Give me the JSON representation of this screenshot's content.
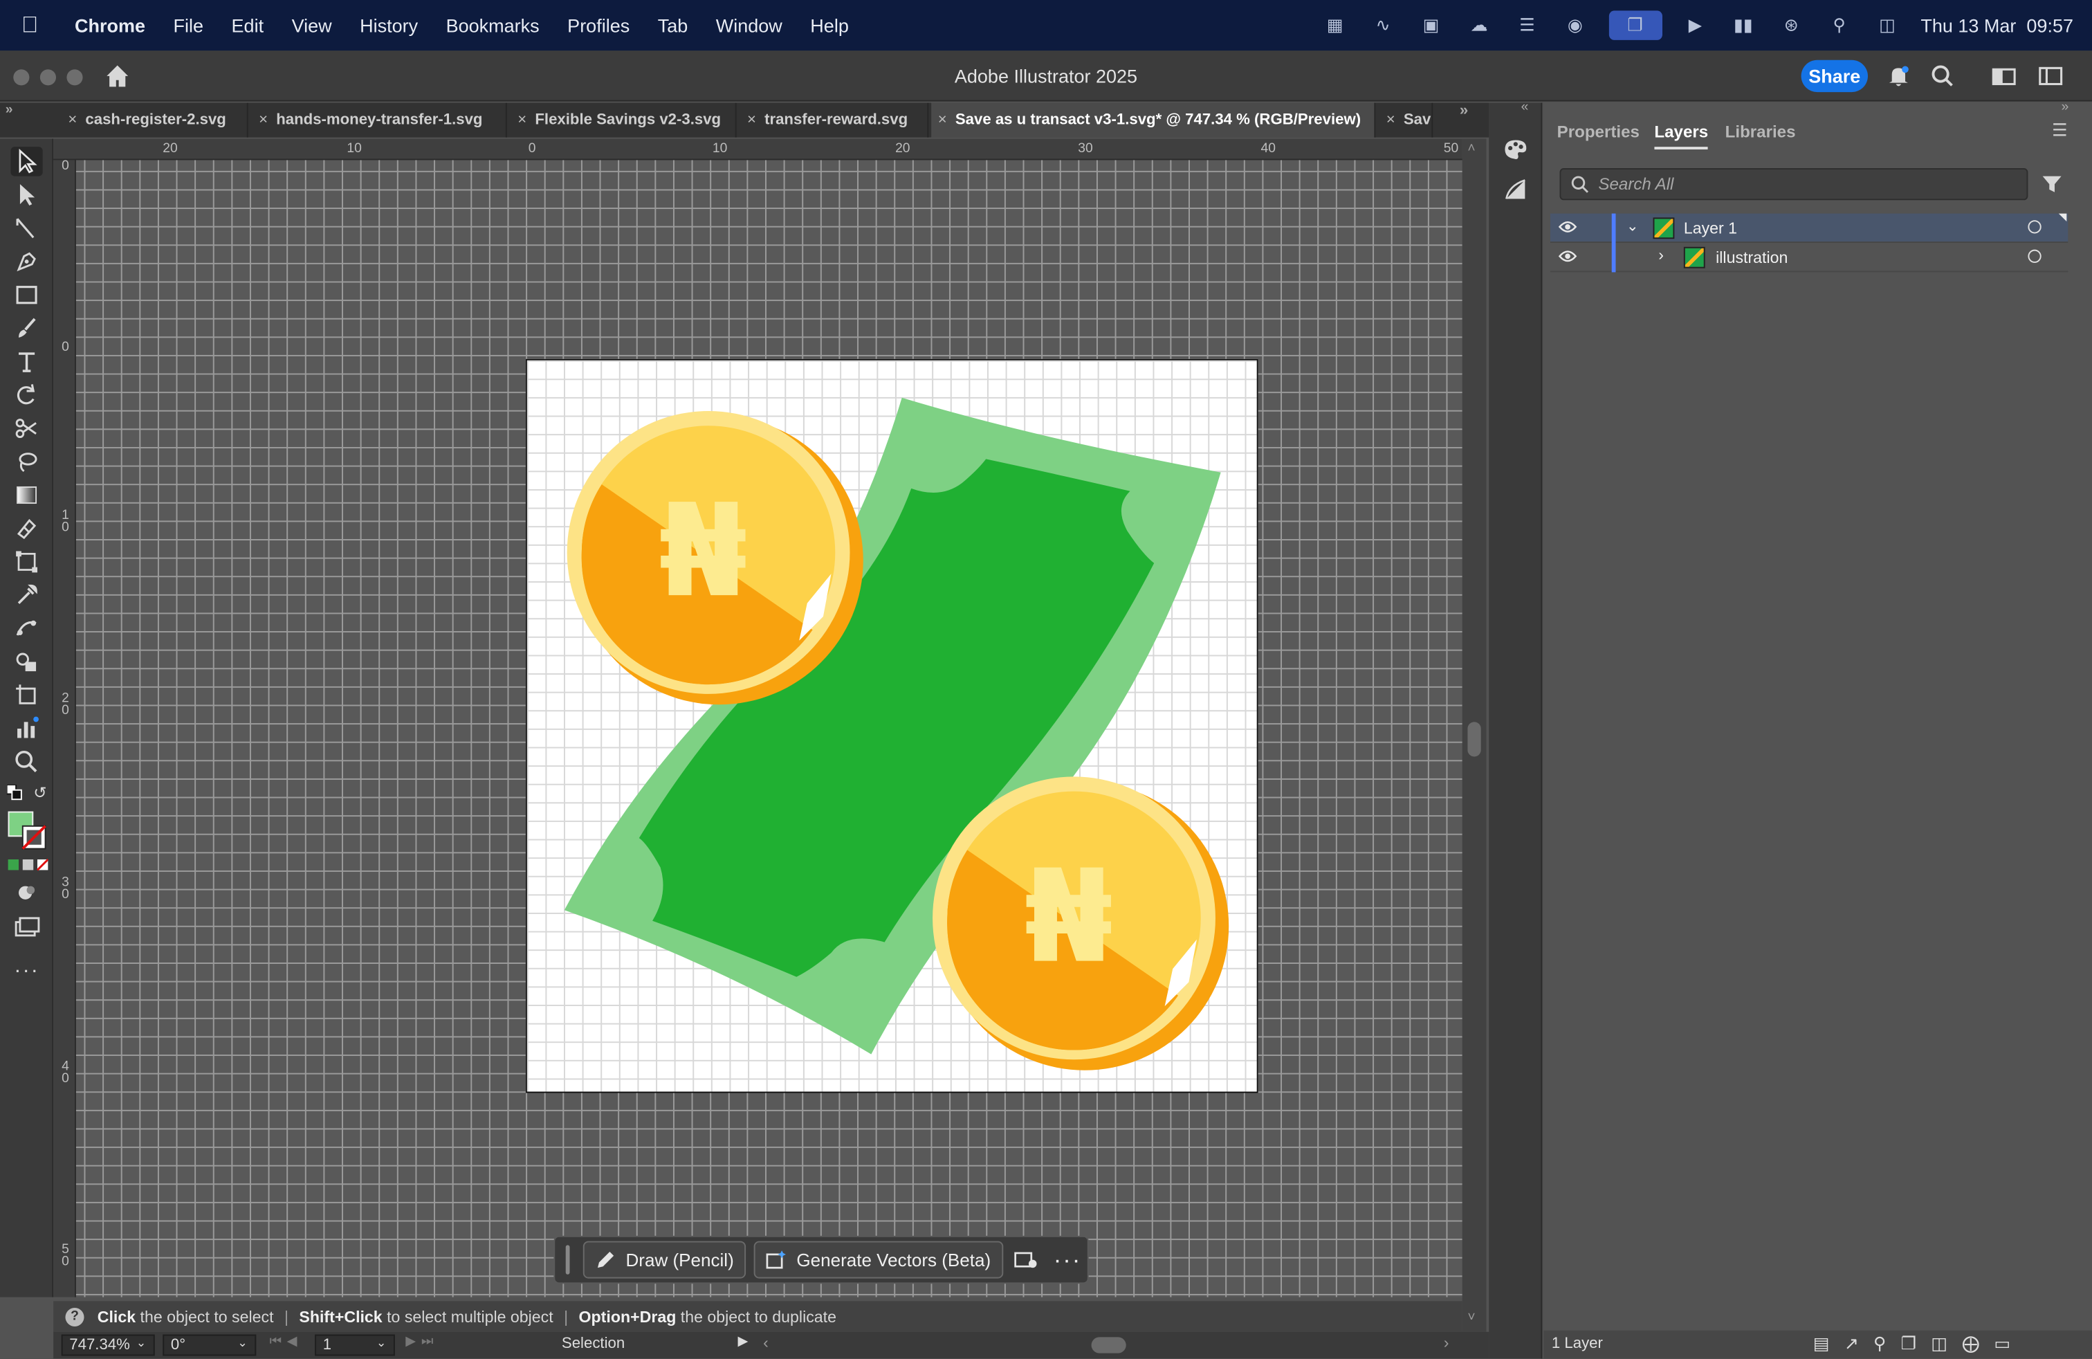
{
  "menubar": {
    "app": "Chrome",
    "items": [
      "File",
      "Edit",
      "View",
      "History",
      "Bookmarks",
      "Profiles",
      "Tab",
      "Window",
      "Help"
    ],
    "clock": "Thu 13 Mar  09:57",
    "icons": [
      "figma-icon",
      "activity-icon",
      "app-icon",
      "creative-cloud-icon",
      "layers-app-icon",
      "cc-sync-icon",
      "screen-mirror-icon",
      "play-icon",
      "battery-icon",
      "wifi-icon",
      "spotlight-icon",
      "control-center-icon"
    ]
  },
  "window": {
    "title": "Adobe Illustrator 2025",
    "share_label": "Share"
  },
  "tabs": [
    {
      "label": "cash-register-2.svg"
    },
    {
      "label": "hands-money-transfer-1.svg"
    },
    {
      "label": "Flexible Savings v2-3.svg"
    },
    {
      "label": "transfer-reward.svg"
    },
    {
      "label": "Save as u transact v3-1.svg* @ 747.34 % (RGB/Preview)",
      "active": true
    },
    {
      "label": "Sav"
    }
  ],
  "ruler": {
    "top_ticks": [
      "20",
      "10",
      "0",
      "10",
      "20",
      "30",
      "40",
      "50"
    ],
    "left_ticks": [
      "0",
      "0",
      "1\n0",
      "2\n0",
      "3\n0",
      "4\n0",
      "5\n0"
    ]
  },
  "taskbar": {
    "draw_label": "Draw (Pencil)",
    "generate_label": "Generate Vectors (Beta)"
  },
  "hint": {
    "k1": "Click",
    "t1": " the object to select",
    "k2": "Shift+Click",
    "t2": " to select multiple object",
    "k3": "Option+Drag",
    "t3": " the object to duplicate"
  },
  "bottom": {
    "zoom": "747.34%",
    "rotation": "0°",
    "artboard": "1",
    "tool": "Selection"
  },
  "panel": {
    "tabs": [
      "Properties",
      "Layers",
      "Libraries"
    ],
    "active_tab": "Layers",
    "search_placeholder": "Search All",
    "layers": [
      {
        "name": "Layer 1",
        "expanded": true,
        "selected": true
      },
      {
        "name": "illustration",
        "expanded": false,
        "selected": false
      }
    ],
    "footer": "1 Layer"
  },
  "colors": {
    "money_dark": "#20b032",
    "money_light": "#7ed184",
    "coin_light": "#fdd24a",
    "coin_dark": "#f8a20e",
    "naira": "#fdeb90"
  },
  "artwork": {
    "coin_symbol": "₦"
  }
}
